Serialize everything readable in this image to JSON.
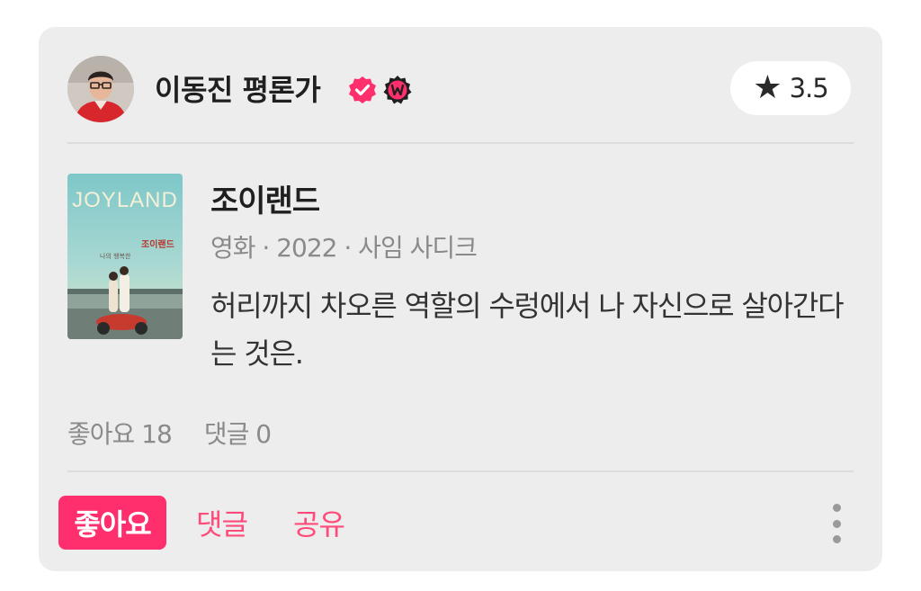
{
  "review_card": {
    "author": {
      "name": "이동진 평론가",
      "badges": [
        "verified-check-icon",
        "watcha-w-badge-icon"
      ]
    },
    "rating": {
      "icon": "star-icon",
      "value": "3.5"
    },
    "work": {
      "poster": {
        "title_text": "JOYLAND",
        "title_ko": "조이랜드"
      },
      "title": "조이랜드",
      "meta": "영화 · 2022 · 사임 사디크"
    },
    "review_text": "허리까지 차오른 역할의 수렁에서 나 자신으로 살아간다는 것은.",
    "stats": {
      "likes": "좋아요 18",
      "comments": "댓글 0"
    },
    "actions": {
      "like_label": "좋아요",
      "comment_label": "댓글",
      "share_label": "공유",
      "more_icon": "more-vertical-icon"
    },
    "colors": {
      "accent": "#ff2f6e",
      "card_bg": "#ededed",
      "badge_pink": "#ff2f6e"
    }
  }
}
